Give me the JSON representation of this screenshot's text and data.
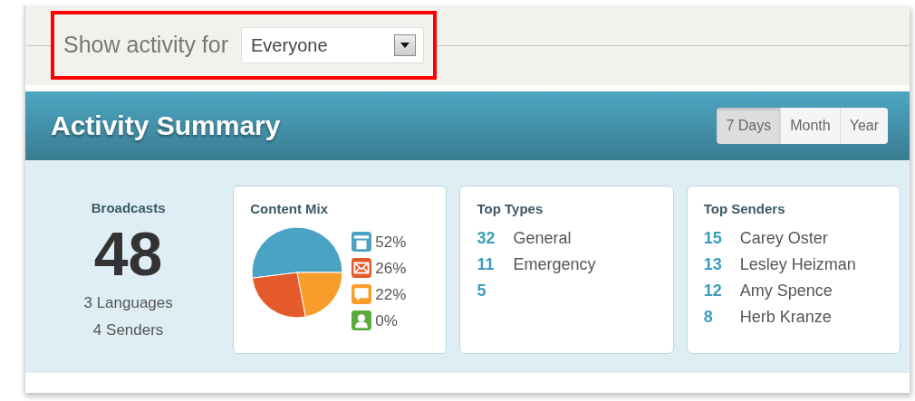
{
  "filter": {
    "label": "Show activity for",
    "value": "Everyone",
    "highlighted": true
  },
  "summary": {
    "title": "Activity Summary",
    "ranges": [
      {
        "label": "7 Days",
        "selected": true
      },
      {
        "label": "Month",
        "selected": false
      },
      {
        "label": "Year",
        "selected": false
      }
    ],
    "broadcasts": {
      "label": "Broadcasts",
      "count": "48",
      "lines": [
        "3 Languages",
        "4 Senders"
      ]
    },
    "content_mix": {
      "title": "Content Mix",
      "legend": [
        {
          "kind": "phone",
          "color": "#4aa3c2",
          "value": "52%"
        },
        {
          "kind": "email",
          "color": "#e55a2b",
          "value": "26%"
        },
        {
          "kind": "sms",
          "color": "#f99d2a",
          "value": "22%"
        },
        {
          "kind": "app",
          "color": "#5aab3c",
          "value": "0%"
        }
      ],
      "chart_data": {
        "type": "pie",
        "values": [
          52,
          26,
          22,
          0
        ]
      }
    },
    "top_types": {
      "title": "Top Types",
      "rows": [
        {
          "count": "32",
          "name": "General"
        },
        {
          "count": "11",
          "name": "Emergency"
        },
        {
          "count": "5"
        }
      ]
    },
    "top_senders": {
      "title": "Top Senders",
      "rows": [
        {
          "count": "15",
          "name": "Carey Oster"
        },
        {
          "count": "13",
          "name": "Lesley Heizman"
        },
        {
          "count": "12",
          "name": "Amy Spence"
        },
        {
          "count": "8",
          "name": "Herb Kranze"
        }
      ]
    }
  }
}
